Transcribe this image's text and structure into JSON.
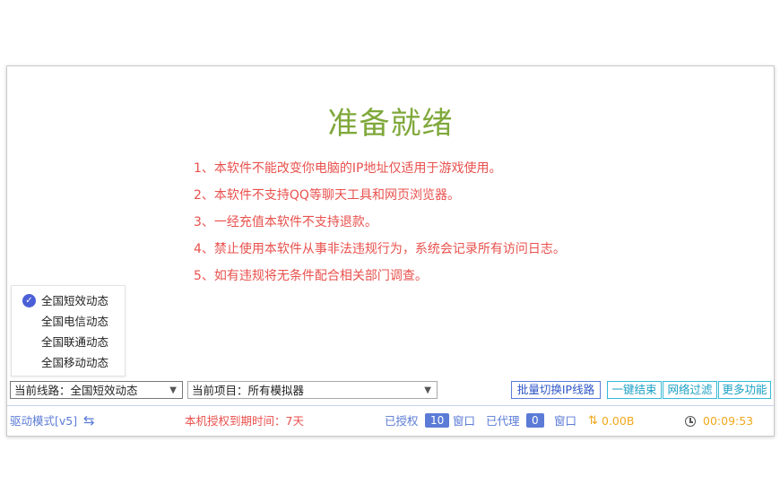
{
  "main": {
    "title": "准备就绪",
    "notices": [
      "1、本软件不能改变你电脑的IP地址仅适用于游戏使用。",
      "2、本软件不支持QQ等聊天工具和网页浏览器。",
      "3、一经充值本软件不支持退款。",
      "4、禁止使用本软件从事非法违规行为，系统会记录所有访问日志。",
      "5、如有违规将无条件配合相关部门调查。"
    ]
  },
  "line_menu": {
    "selected_index": 0,
    "options": [
      "全国短效动态",
      "全国电信动态",
      "全国联通动态",
      "全国移动动态"
    ]
  },
  "toolbar": {
    "line_label": "当前线路：",
    "line_value": "全国短效动态",
    "project_label": "当前项目：",
    "project_value": "所有模拟器",
    "batch_button": "批量切换IP线路",
    "end_button": "一键结束",
    "filter_button": "网络过滤",
    "more_button": "更多功能"
  },
  "status": {
    "drive_mode": "驱动模式[v5]",
    "expiry_text": "本机授权到期时间：7天",
    "authorized_label": "已授权",
    "authorized_count": "10",
    "window_unit_1": "窗口",
    "proxied_label": "已代理",
    "proxied_count": "0",
    "window_unit_2": "窗口",
    "traffic": "0.00B",
    "timer": "00:09:53"
  },
  "colors": {
    "title": "#7fa83a",
    "notice": "#e8514d",
    "accent": "#5b7bd6",
    "cyan": "#38b9d6",
    "orange": "#f0a81c"
  }
}
